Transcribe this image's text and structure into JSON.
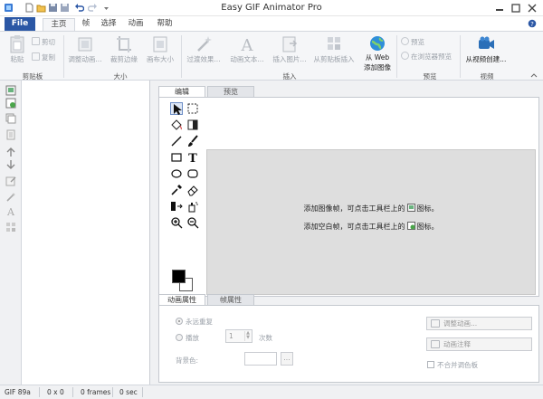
{
  "window": {
    "title": "Easy GIF Animator Pro"
  },
  "tabs": {
    "file": "File",
    "items": [
      "主页",
      "帧",
      "选择",
      "动画",
      "帮助"
    ],
    "active": "主页"
  },
  "ribbon": {
    "clipboard": {
      "paste": "粘贴",
      "cut": "剪切",
      "copy": "复制",
      "group": "剪贴板"
    },
    "size": {
      "resize_anim": "调整动画...",
      "crop_edges": "裁剪边缘",
      "canvas_size": "画布大小",
      "group": "大小"
    },
    "insert": {
      "transition": "过渡效果...",
      "anim_text": "动画文本...",
      "insert_image": "插入图片...",
      "from_clipboard": "从剪贴板插入",
      "from_web_line1": "从 Web",
      "from_web_line2": "添加图像",
      "group": "插入"
    },
    "preview": {
      "preview": "预览",
      "browser_preview": "在浏览器预览",
      "group": "预览"
    },
    "video": {
      "from_video": "从视频创建...",
      "group": "视频"
    }
  },
  "panel_tabs": {
    "edit": "编辑",
    "preview": "预览"
  },
  "canvas": {
    "hint1_pre": "添加图像帧，可点击工具栏上的",
    "hint1_post": "图标。",
    "hint2_pre": "添加空白帧，可点击工具栏上的",
    "hint2_post": "图标。"
  },
  "props": {
    "tab_anim": "动画属性",
    "tab_frame": "帧属性",
    "loop_forever": "永远重复",
    "play": "播放",
    "play_count": "1",
    "times": "次数",
    "bg_color": "背景色:",
    "browse": "...",
    "adjust_anim": "调整动画...",
    "anim_comment": "动画注释",
    "no_merge_palette": "不合并调色板"
  },
  "status": {
    "format": "GIF 89a",
    "size": "0 x 0",
    "frames": "0 frames",
    "time": "0 sec"
  },
  "colors": {
    "accent": "#2b57a5",
    "fg_swatch": "#000000",
    "bg_swatch": "#ffffff"
  }
}
